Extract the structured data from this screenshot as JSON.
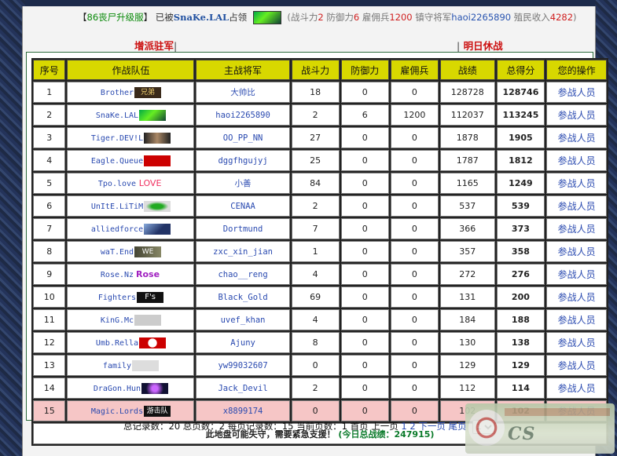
{
  "header": {
    "server": "86丧尸升级服",
    "bracket_open": "【",
    "bracket_close": "】",
    "taken_text": "已被",
    "occupier": "SnaKe.LAL",
    "occupy_text": "占领",
    "combat_label": "战斗力",
    "combat": "2",
    "defense_label": "防御力",
    "defense": "6",
    "merc_label": "雇佣兵",
    "merc": "1200",
    "general_label": "镇守将军",
    "general": "haoi2265890",
    "income_label": "殖民收入",
    "income": "4282",
    "paren_open": "(",
    "paren_close": ")"
  },
  "tabs": {
    "left": "增派驻军",
    "right": "明日休战",
    "sep": "|"
  },
  "table": {
    "columns": [
      "序号",
      "作战队伍",
      "主战将军",
      "战斗力",
      "防御力",
      "雇佣兵",
      "战绩",
      "总得分",
      "您的操作"
    ],
    "rows": [
      {
        "no": "1",
        "team": "Brother",
        "badge": "兄弟",
        "general": "大帅比",
        "combat": "18",
        "defense": "0",
        "merc": "0",
        "record": "128728",
        "score": "128746",
        "action": "参战人员"
      },
      {
        "no": "2",
        "team": "SnaKe.LAL",
        "badge": "snake",
        "general": "haoi2265890",
        "combat": "2",
        "defense": "6",
        "merc": "1200",
        "record": "112037",
        "score": "113245",
        "action": "参战人员"
      },
      {
        "no": "3",
        "team": "Tiger.DEV!L",
        "badge": "tiger",
        "general": "OO_PP_NN",
        "combat": "27",
        "defense": "0",
        "merc": "0",
        "record": "1878",
        "score": "1905",
        "action": "参战人员"
      },
      {
        "no": "4",
        "team": "Eagle.Queue",
        "badge": "eagle",
        "general": "dggfhgujyj",
        "combat": "25",
        "defense": "0",
        "merc": "0",
        "record": "1787",
        "score": "1812",
        "action": "参战人员"
      },
      {
        "no": "5",
        "team": "Tpo.love",
        "badge": "LOVE",
        "general": "小善",
        "combat": "84",
        "defense": "0",
        "merc": "0",
        "record": "1165",
        "score": "1249",
        "action": "参战人员"
      },
      {
        "no": "6",
        "team": "UnItE.LiTiM",
        "badge": "unite",
        "general": "CENAA",
        "combat": "2",
        "defense": "0",
        "merc": "0",
        "record": "537",
        "score": "539",
        "action": "参战人员"
      },
      {
        "no": "7",
        "team": "alliedforce",
        "badge": "allied",
        "general": "Dortmund",
        "combat": "7",
        "defense": "0",
        "merc": "0",
        "record": "366",
        "score": "373",
        "action": "参战人员"
      },
      {
        "no": "8",
        "team": "waT.End",
        "badge": "WE",
        "general": "zxc_xin_jian",
        "combat": "1",
        "defense": "0",
        "merc": "0",
        "record": "357",
        "score": "358",
        "action": "参战人员"
      },
      {
        "no": "9",
        "team": "Rose.Nz",
        "badge": "Rose",
        "general": "chao__reng",
        "combat": "4",
        "defense": "0",
        "merc": "0",
        "record": "272",
        "score": "276",
        "action": "参战人员"
      },
      {
        "no": "10",
        "team": "Fighters",
        "badge": "F's",
        "general": "Black_Gold",
        "combat": "69",
        "defense": "0",
        "merc": "0",
        "record": "131",
        "score": "200",
        "action": "参战人员"
      },
      {
        "no": "11",
        "team": "KinG.Mc",
        "badge": "king",
        "general": "uvef_khan",
        "combat": "4",
        "defense": "0",
        "merc": "0",
        "record": "184",
        "score": "188",
        "action": "参战人员"
      },
      {
        "no": "12",
        "team": "Umb.Rella",
        "badge": "umbrella",
        "general": "Ajuny",
        "combat": "8",
        "defense": "0",
        "merc": "0",
        "record": "130",
        "score": "138",
        "action": "参战人员"
      },
      {
        "no": "13",
        "team": "family",
        "badge": "family",
        "general": "yw99032607",
        "combat": "0",
        "defense": "0",
        "merc": "0",
        "record": "129",
        "score": "129",
        "action": "参战人员"
      },
      {
        "no": "14",
        "team": "DraGon.Hun",
        "badge": "dragon",
        "general": "Jack_Devil",
        "combat": "2",
        "defense": "0",
        "merc": "0",
        "record": "112",
        "score": "114",
        "action": "参战人员"
      },
      {
        "no": "15",
        "team": "Magic.Lords",
        "badge": "游击队",
        "general": "x8899174",
        "combat": "0",
        "defense": "0",
        "merc": "0",
        "record": "102",
        "score": "102",
        "action": "参战人员"
      }
    ],
    "danger_row": "15",
    "footer_warning": "此地盘可能失守，需要紧急支援！",
    "footer_total": "(今日总战绩：247915)"
  },
  "pager": {
    "total_label": "总记录数：",
    "total": "20",
    "pages_label": "总页数：",
    "pages": "2",
    "per_label": "每页记录数：",
    "per": "15",
    "current_label": "当前页数：",
    "current": "1",
    "first": "首页",
    "prev": "上一页",
    "p1": "1",
    "p2": "2",
    "next": "下一页",
    "last": "尾页",
    "select_value": "1"
  },
  "colors": {
    "header_cell": "#d8d800",
    "accent_red": "#d01010",
    "link_blue": "#2a4ab0",
    "danger_row": "#f6c6c6"
  }
}
